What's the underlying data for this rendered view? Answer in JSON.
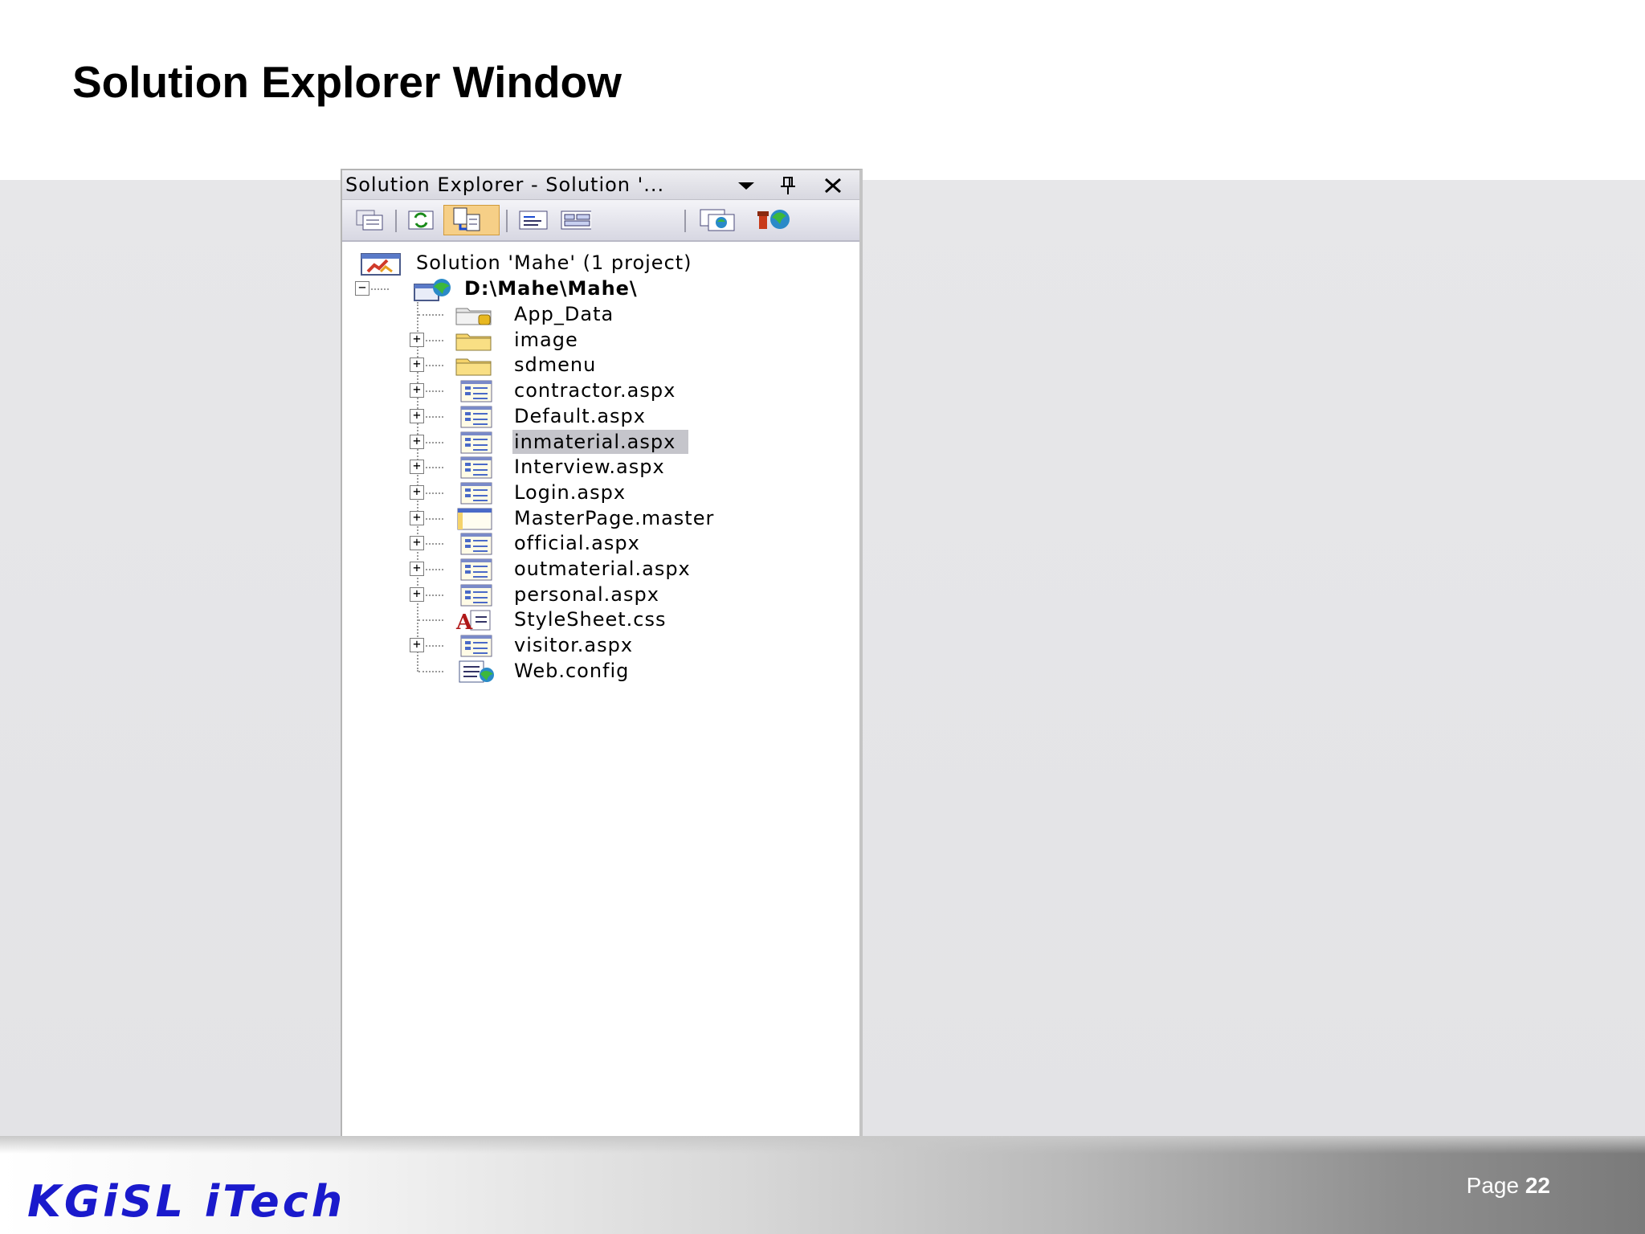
{
  "slide": {
    "title": "Solution Explorer Window",
    "logo": "KGiSL iTech",
    "page_label": "Page",
    "page_number": "22"
  },
  "panel": {
    "title": "Solution Explorer - Solution '...",
    "title_buttons": [
      {
        "name": "dropdown-arrow-icon"
      },
      {
        "name": "pin-icon"
      },
      {
        "name": "close-icon"
      }
    ],
    "toolbar": [
      {
        "name": "properties-icon"
      },
      {
        "name": "refresh-icon"
      },
      {
        "name": "nest-related-files-icon",
        "active": true
      },
      {
        "name": "view-code-icon"
      },
      {
        "name": "view-designer-icon"
      },
      {
        "name": "copy-website-icon"
      },
      {
        "name": "asp-net-configuration-icon"
      }
    ],
    "solution": {
      "label": "Solution 'Mahe' (1 project)",
      "icon": "solution-icon"
    },
    "project": {
      "label": "D:\\Mahe\\Mahe\\",
      "icon": "web-project-icon",
      "expanded": true
    },
    "items": [
      {
        "label": "App_Data",
        "icon": "app-data-folder-icon",
        "expandable": false
      },
      {
        "label": "image",
        "icon": "folder-icon",
        "expandable": true
      },
      {
        "label": "sdmenu",
        "icon": "folder-icon",
        "expandable": true
      },
      {
        "label": "contractor.aspx",
        "icon": "aspx-file-icon",
        "expandable": true
      },
      {
        "label": "Default.aspx",
        "icon": "aspx-file-icon",
        "expandable": true
      },
      {
        "label": "inmaterial.aspx",
        "icon": "aspx-file-icon",
        "expandable": true,
        "selected": true
      },
      {
        "label": "Interview.aspx",
        "icon": "aspx-file-icon",
        "expandable": true
      },
      {
        "label": "Login.aspx",
        "icon": "aspx-file-icon",
        "expandable": true
      },
      {
        "label": "MasterPage.master",
        "icon": "master-page-icon",
        "expandable": true
      },
      {
        "label": "official.aspx",
        "icon": "aspx-file-icon",
        "expandable": true
      },
      {
        "label": "outmaterial.aspx",
        "icon": "aspx-file-icon",
        "expandable": true
      },
      {
        "label": "personal.aspx",
        "icon": "aspx-file-icon",
        "expandable": true
      },
      {
        "label": "StyleSheet.css",
        "icon": "css-file-icon",
        "expandable": false
      },
      {
        "label": "visitor.aspx",
        "icon": "aspx-file-icon",
        "expandable": true
      },
      {
        "label": "Web.config",
        "icon": "config-file-icon",
        "expandable": false
      }
    ],
    "colors": {
      "selection": "#c5c5cb",
      "folder": "#f5d36a",
      "toolbar_active": "#f6cf87"
    }
  }
}
